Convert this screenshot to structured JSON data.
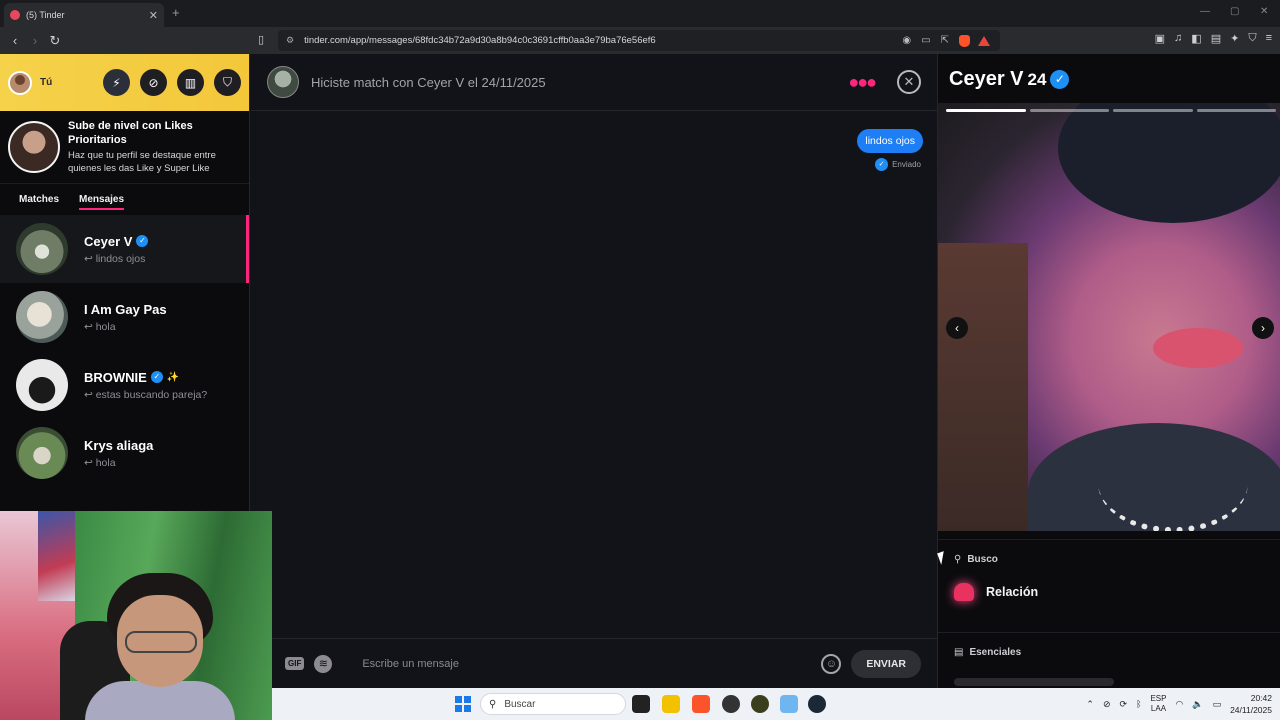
{
  "browser": {
    "tab_title": "(5) Tinder",
    "tab_close": "✕",
    "new_tab": "+",
    "url": "tinder.com/app/messages/68fdc34b72a9d30a8b94c0c3691cffb0aa3e79ba76e56ef6"
  },
  "sidebar": {
    "me_label": "Tú",
    "promo_title": "Sube de nivel con Likes Prioritarios",
    "promo_sub": "Haz que tu perfil se destaque entre quienes les das Like y Super Like",
    "tabs": [
      "Matches",
      "Mensajes"
    ],
    "conversations": [
      {
        "name": "Ceyer V",
        "preview": "↩ lindos ojos",
        "verified": true
      },
      {
        "name": "I Am Gay Pas",
        "preview": "↩ hola",
        "verified": false
      },
      {
        "name": "BROWNIE",
        "preview": "↩ estas buscando pareja?",
        "verified": true
      },
      {
        "name": "Krys aliaga",
        "preview": "↩ hola",
        "verified": false
      }
    ]
  },
  "chat": {
    "header_title": "Hiciste match con Ceyer V el 24/11/2025",
    "messages": [
      {
        "text": "lindos ojos",
        "status": "Enviado"
      }
    ],
    "input_placeholder": "Escribe un mensaje",
    "gif_label": "GIF",
    "send_label": "ENVIAR"
  },
  "profile": {
    "name": "Ceyer V",
    "age": "24",
    "photo_count": 4,
    "photo_active_index": 0,
    "looking_for_label": "Busco",
    "looking_for_value": "Relación",
    "essentials_label": "Esenciales"
  },
  "taskbar": {
    "search_label": "Buscar",
    "lang_1": "ESP",
    "lang_2": "LAA",
    "time": "20:42",
    "date": "24/11/2025"
  },
  "colors": {
    "accent_pink": "#fd267d",
    "bubble_blue": "#1d7ef5",
    "header_yellow": "#f5d24a"
  }
}
